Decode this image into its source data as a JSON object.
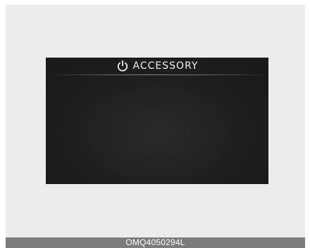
{
  "display": {
    "mode_label": "ACCESSORY",
    "mode_icon": "power-icon"
  },
  "caption": {
    "code": "OMQ4050294L"
  },
  "colors": {
    "page_background": "#ececec",
    "screen_background": "#1f1e1d",
    "label_color": "#f2f2f2",
    "caption_bar": "#7b7b7b",
    "caption_text": "#ffffff"
  }
}
